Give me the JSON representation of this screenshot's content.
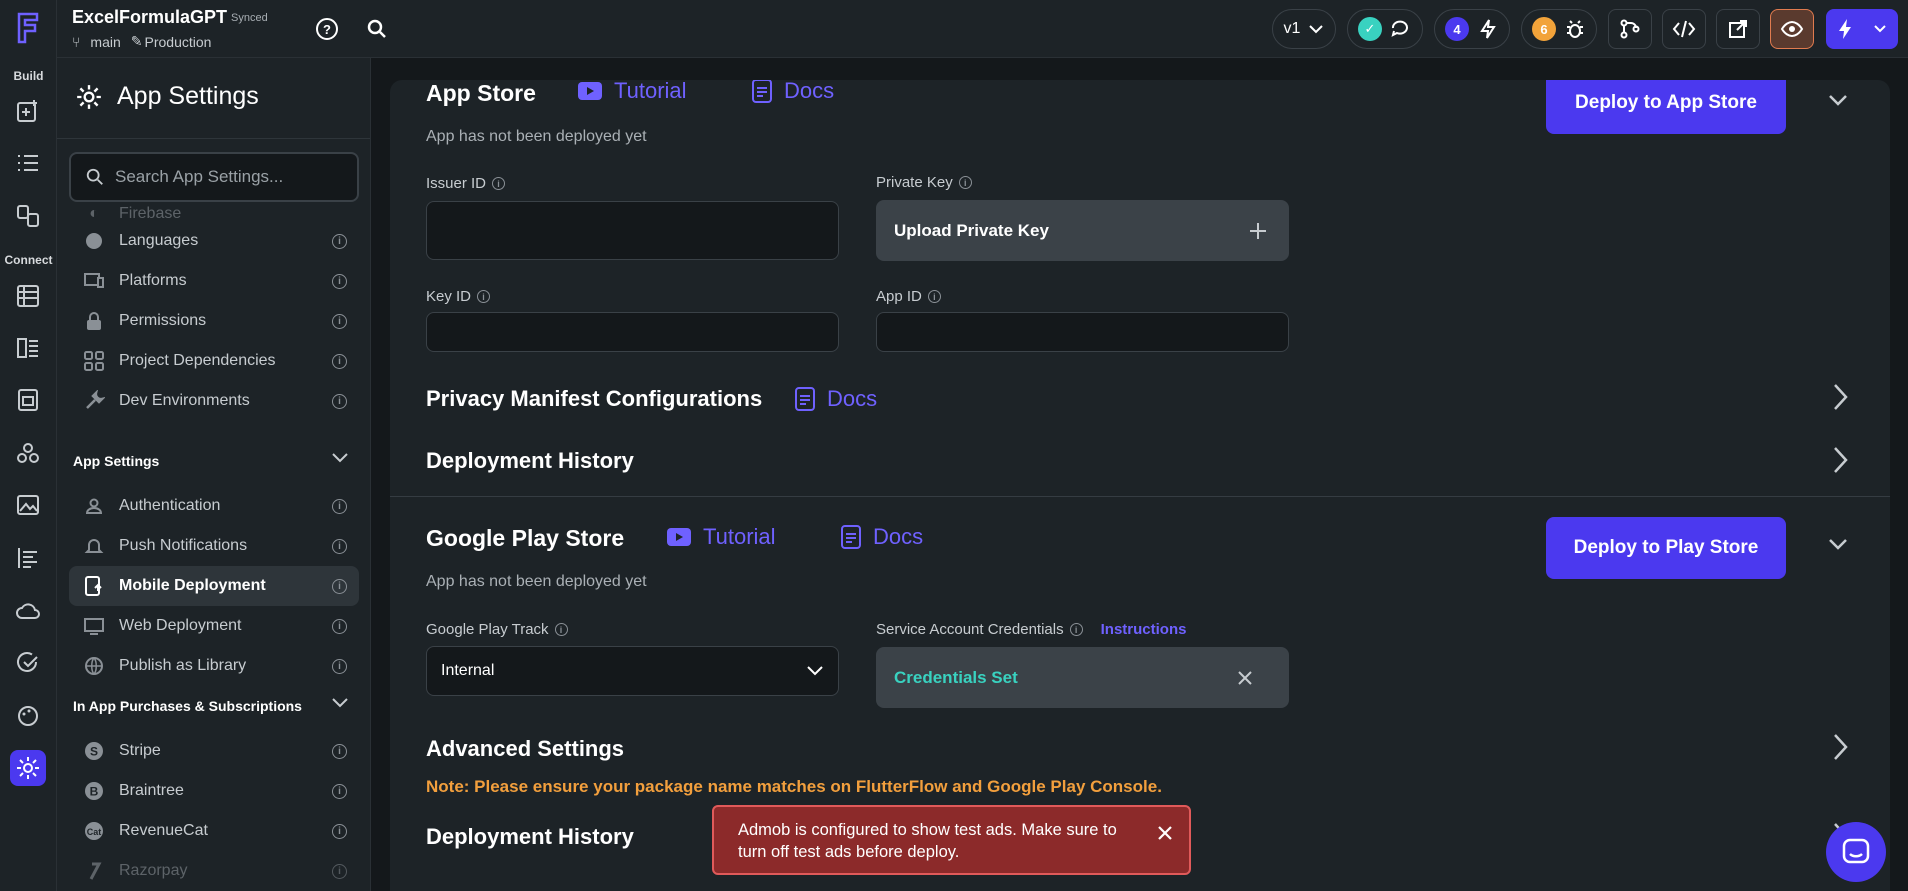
{
  "topbar": {
    "project_name": "ExcelFormulaGPT",
    "synced": "Synced",
    "branch": "main",
    "environment": "Production",
    "version": "v1",
    "notif_count": "4",
    "bug_count": "6",
    "colors": {
      "accent": "#4b39ef",
      "success": "#39d2c0",
      "warning": "#f2a33a"
    }
  },
  "rail": {
    "build_label": "Build",
    "connect_label": "Connect"
  },
  "sidebar": {
    "title": "App Settings",
    "search_placeholder": "Search App Settings...",
    "items_top": [
      {
        "label": "Firebase"
      },
      {
        "label": "Languages"
      },
      {
        "label": "Platforms"
      },
      {
        "label": "Permissions"
      },
      {
        "label": "Project Dependencies"
      },
      {
        "label": "Dev Environments"
      }
    ],
    "section_app_settings": "App Settings",
    "items_app": [
      {
        "label": "Authentication"
      },
      {
        "label": "Push Notifications"
      },
      {
        "label": "Mobile Deployment"
      },
      {
        "label": "Web Deployment"
      },
      {
        "label": "Publish as Library"
      }
    ],
    "section_iap": "In App Purchases & Subscriptions",
    "items_iap": [
      {
        "label": "Stripe"
      },
      {
        "label": "Braintree"
      },
      {
        "label": "RevenueCat"
      },
      {
        "label": "Razorpay"
      }
    ]
  },
  "app_store": {
    "title": "App Store",
    "tutorial": "Tutorial",
    "docs": "Docs",
    "status": "App has not been deployed yet",
    "deploy_button": "Deploy to App Store",
    "issuer_id_label": "Issuer ID",
    "private_key_label": "Private Key",
    "upload_private_key": "Upload Private Key",
    "key_id_label": "Key ID",
    "app_id_label": "App ID",
    "privacy_manifest": "Privacy Manifest Configurations",
    "privacy_docs": "Docs",
    "deployment_history": "Deployment History"
  },
  "play_store": {
    "title": "Google Play Store",
    "tutorial": "Tutorial",
    "docs": "Docs",
    "status": "App has not been deployed yet",
    "deploy_button": "Deploy to Play Store",
    "track_label": "Google Play Track",
    "track_value": "Internal",
    "credentials_label": "Service Account Credentials",
    "instructions": "Instructions",
    "credentials_set": "Credentials Set",
    "advanced_settings": "Advanced Settings",
    "note": "Note: Please ensure your package name matches on FlutterFlow and Google Play Console.",
    "deployment_history": "Deployment History"
  },
  "toast": {
    "message": "Admob is configured to show test ads. Make sure to turn off test ads before deploy."
  }
}
